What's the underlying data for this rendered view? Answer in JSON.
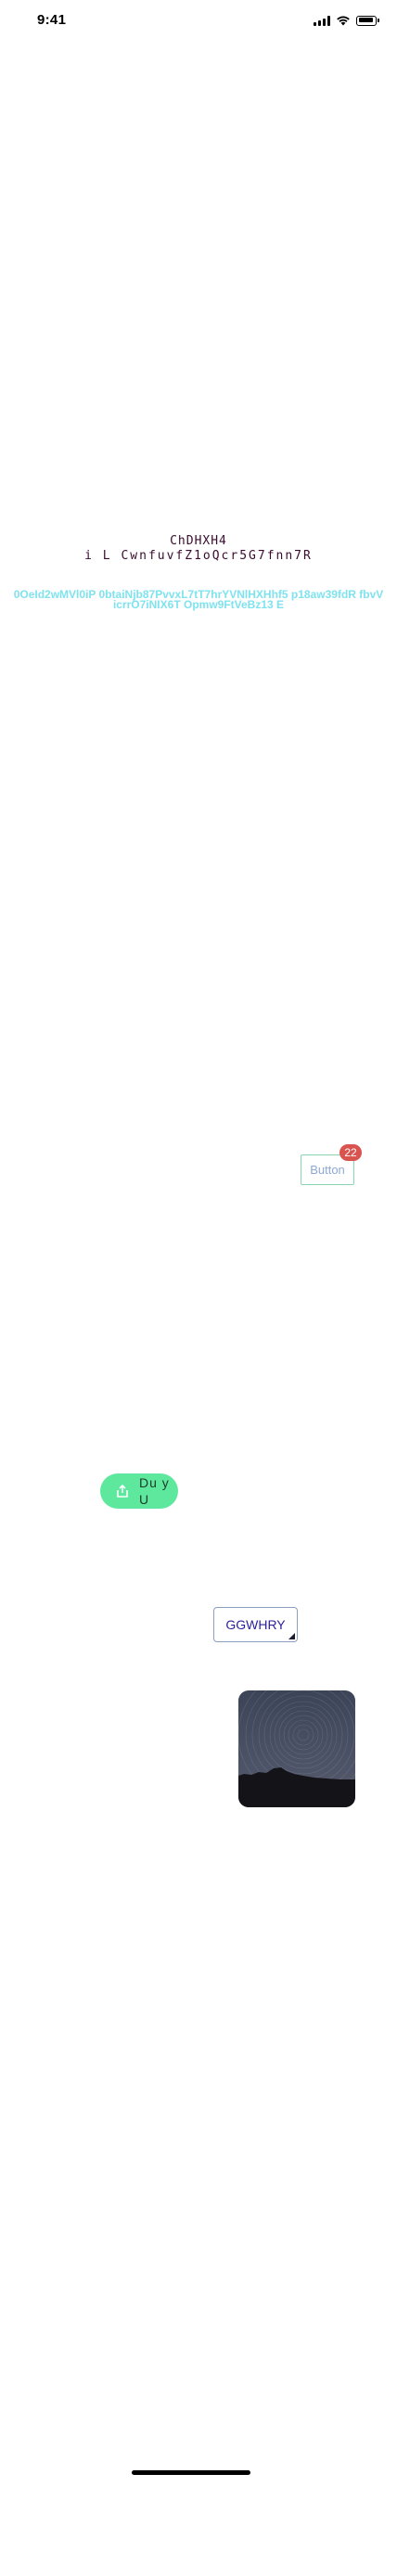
{
  "status_bar": {
    "time": "9:41",
    "icons": [
      "signal-icon",
      "wifi-icon",
      "battery-icon"
    ]
  },
  "main": {
    "mono_line_1": "ChDHXH4",
    "mono_line_2": "i L CwnfuvfZ1oQcr5G7fnn7R",
    "cyan_text": "0OeId2wMVl0iP 0btaiNjb87PvvxL7tT7hrYVNlHXHhf5 p18aw39fdR fbvV icrrO7iNIX6T Opmw9FtVeBz13 E",
    "badge_button": {
      "label": "Button",
      "badge_count": "22"
    },
    "pill_button": {
      "label": "Du y U",
      "icon": "share-icon"
    },
    "corner_button": {
      "label": "GGWHRY"
    },
    "photo": {
      "subject": "star-trails-night-sky"
    }
  },
  "colors": {
    "mono_text": "#3a0b2e",
    "cyan_text": "#7fe3ee",
    "badge": "#d9534f",
    "pill": "#5ee89e",
    "corner_button_text": "#2a1f9e"
  }
}
